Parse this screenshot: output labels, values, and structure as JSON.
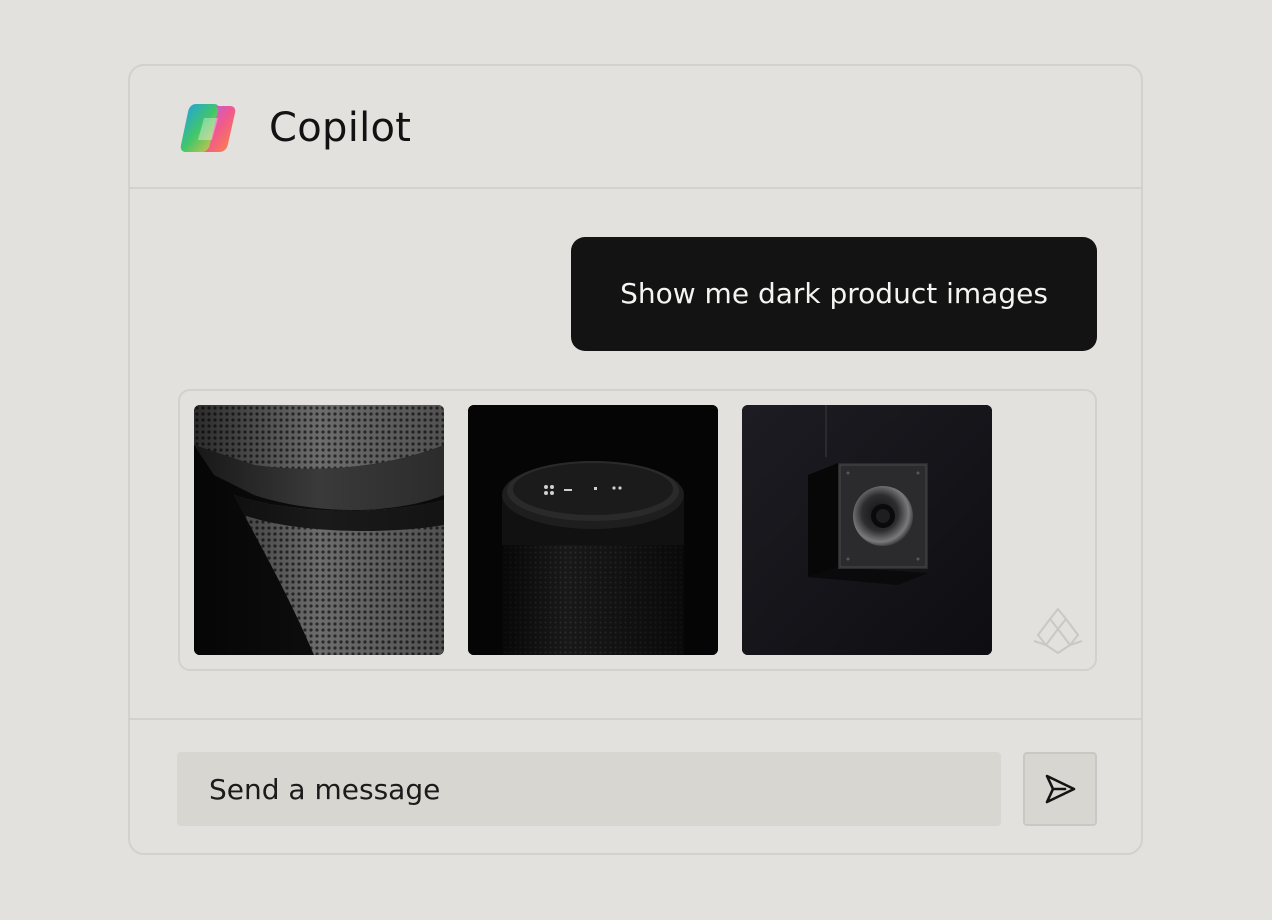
{
  "app": {
    "title": "Copilot",
    "logo_icon": "copilot-logo-icon"
  },
  "conversation": {
    "user_message": "Show me dark product images",
    "images": [
      {
        "name": "speaker-mesh-closeup-image"
      },
      {
        "name": "cylindrical-smart-speaker-image"
      },
      {
        "name": "hanging-cube-speaker-image"
      }
    ],
    "watermark_icon": "watermark-logo-icon"
  },
  "composer": {
    "placeholder": "Send a message",
    "value": "",
    "send_icon": "send-icon"
  },
  "colors": {
    "background": "#e2e1dd",
    "border": "#d2d1cd",
    "bubble": "#141313",
    "bubble_text": "#f4f4f2",
    "input_bg": "#d8d6d1"
  }
}
